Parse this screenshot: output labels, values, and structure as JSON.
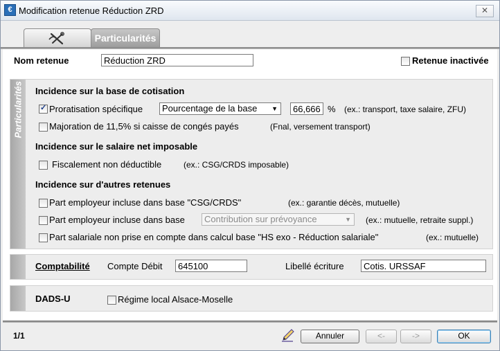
{
  "window": {
    "title": "Modification retenue Réduction ZRD",
    "close_glyph": "✕",
    "app_icon_glyph": "€"
  },
  "tabs": [
    {
      "label": ""
    },
    {
      "label": "Particularités"
    }
  ],
  "header": {
    "nom_label": "Nom retenue",
    "nom_value": "Réduction ZRD",
    "inactive_label": "Retenue inactivée",
    "inactive_checked": false
  },
  "particularites": {
    "side_label": "Particularités",
    "base": {
      "heading": "Incidence sur la base de cotisation",
      "proratisation_label": "Proratisation spécifique",
      "proratisation_checked": true,
      "proratisation_select": "Pourcentage de la base",
      "proratisation_value": "66,666",
      "percent_symbol": "%",
      "proratisation_hint": "(ex.: transport, taxe salaire, ZFU)",
      "majoration_label": "Majoration de 11,5% si caisse de congés payés",
      "majoration_checked": false,
      "majoration_hint": "(Fnal, versement transport)"
    },
    "net": {
      "heading": "Incidence sur le salaire net imposable",
      "fiscal_label": "Fiscalement non déductible",
      "fiscal_checked": false,
      "fiscal_hint": "(ex.: CSG/CRDS imposable)"
    },
    "autres": {
      "heading": "Incidence sur d'autres retenues",
      "row1_label": "Part employeur incluse dans base \"CSG/CRDS\"",
      "row1_hint": "(ex.: garantie décès, mutuelle)",
      "row2_label": "Part employeur incluse dans base",
      "row2_select": "Contribution sur prévoyance",
      "row2_hint": "(ex.: mutuelle, retraite suppl.)",
      "row3_label": "Part salariale non prise en compte dans calcul base \"HS exo - Réduction salariale\"",
      "row3_hint": "(ex.: mutuelle)"
    }
  },
  "comptabilite": {
    "label": "Comptabilité",
    "compte_label": "Compte Débit",
    "compte_value": "645100",
    "libelle_label": "Libellé écriture",
    "libelle_value": "Cotis. URSSAF"
  },
  "dads": {
    "label": "DADS-U",
    "regime_label": "Régime local Alsace-Moselle",
    "regime_checked": false
  },
  "footer": {
    "page_indicator": "1/1",
    "annuler": "Annuler",
    "prev": "<-",
    "next": "->",
    "ok": "OK"
  }
}
